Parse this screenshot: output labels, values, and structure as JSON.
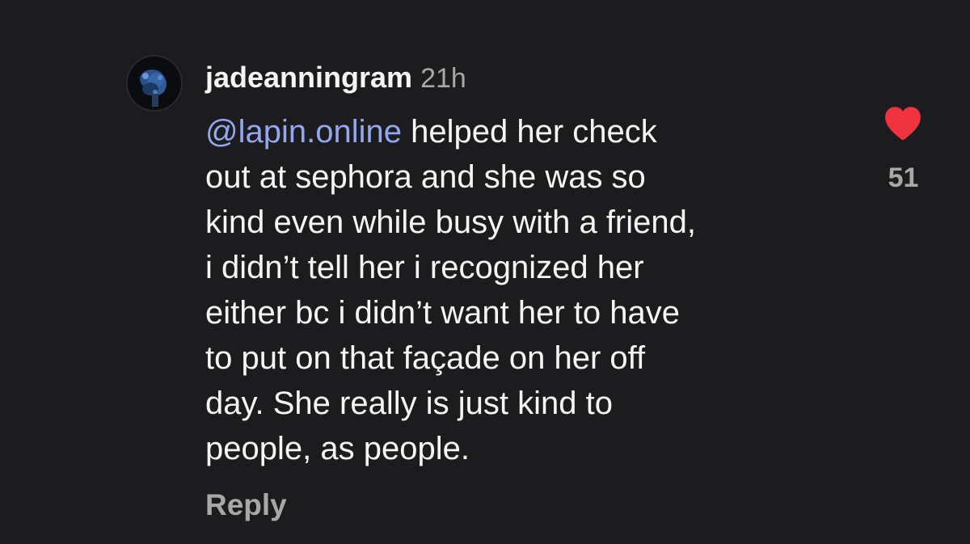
{
  "comment": {
    "username": "jadeanningram",
    "time": "21h",
    "mention": "@lapin.online",
    "text_line_1": " helped her check",
    "text_line_2": "out at sephora and she was so",
    "text_line_3": "kind even while busy with a friend,",
    "text_line_4": "i didn’t tell her i recognized her",
    "text_line_5": "either bc i didn’t want her to have",
    "text_line_6": "to put on that façade on her off",
    "text_line_7": "day. She really is just kind to",
    "text_line_8": "people, as people.",
    "reply_label": "Reply",
    "like_count": "51",
    "liked": true
  },
  "icons": {
    "avatar": "profile-avatar-icon",
    "like": "heart-icon"
  },
  "colors": {
    "background": "#1c1c1f",
    "text": "#f5f5f5",
    "secondary_text": "#a8a8a8",
    "mention": "#93a6ee",
    "heart": "#ef3340"
  }
}
